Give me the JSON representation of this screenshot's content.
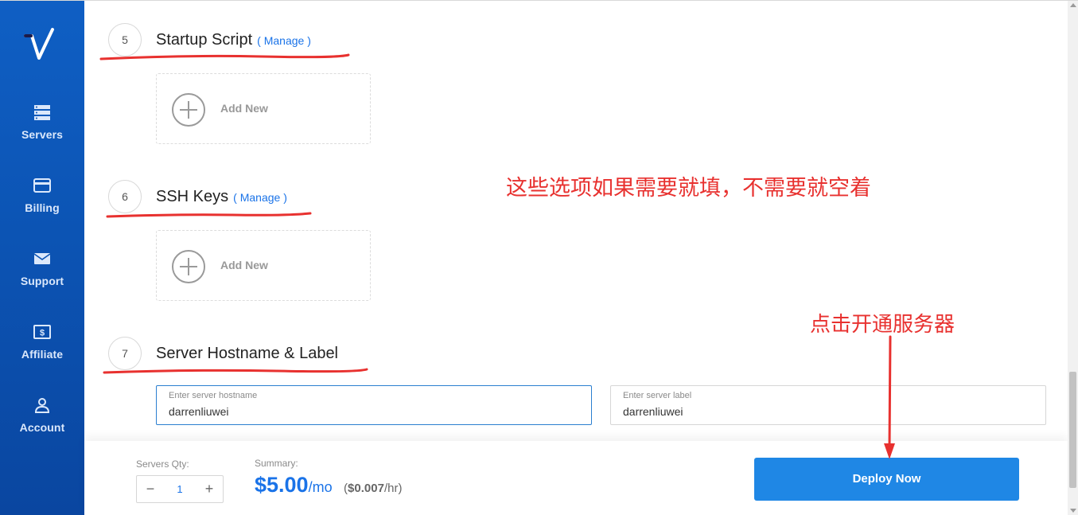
{
  "colors": {
    "sidebar": "#0c54b4",
    "accent": "#1a73e8",
    "deploy_button": "#1f87e5",
    "annotation": "#e8312f"
  },
  "sidebar": {
    "logo": "vultr-v-logo",
    "items": [
      {
        "label": "Servers",
        "icon": "servers-icon"
      },
      {
        "label": "Billing",
        "icon": "credit-card-icon"
      },
      {
        "label": "Support",
        "icon": "envelope-icon"
      },
      {
        "label": "Affiliate",
        "icon": "dollar-icon"
      },
      {
        "label": "Account",
        "icon": "user-icon"
      }
    ]
  },
  "sections": [
    {
      "number": "5",
      "title": "Startup Script",
      "manage": "( Manage )",
      "add_label": "Add New"
    },
    {
      "number": "6",
      "title": "SSH Keys",
      "manage": "( Manage )",
      "add_label": "Add New"
    },
    {
      "number": "7",
      "title": "Server Hostname & Label"
    }
  ],
  "hostname_field": {
    "label": "Enter server hostname",
    "value": "darrenliuwei"
  },
  "label_field": {
    "label": "Enter server label",
    "value": "darrenliuwei"
  },
  "annotations": {
    "optional_note": "这些选项如果需要就填，不需要就空着",
    "deploy_note": "点击开通服务器"
  },
  "footer": {
    "qty_label": "Servers Qty:",
    "qty_value": "1",
    "minus": "−",
    "plus": "+",
    "summary_label": "Summary:",
    "price": "$5.00",
    "per_month": "/mo",
    "hourly_open": "(",
    "hourly_price": "$0.007",
    "per_hour": "/hr)",
    "deploy_label": "Deploy Now"
  }
}
